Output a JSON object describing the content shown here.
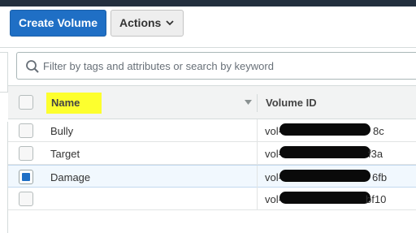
{
  "toolbar": {
    "create_label": "Create Volume",
    "actions_label": "Actions"
  },
  "search": {
    "placeholder": "Filter by tags and attributes or search by keyword"
  },
  "table": {
    "columns": [
      "Name",
      "Volume ID"
    ],
    "rows": [
      {
        "name": "Bully",
        "volume_prefix": "vol-0",
        "volume_suffix": "8c",
        "selected": false
      },
      {
        "name": "Target",
        "volume_prefix": "vol-0",
        "volume_suffix": "f3a",
        "selected": false
      },
      {
        "name": "Damage",
        "volume_prefix": "vol-0",
        "volume_suffix": "6fb",
        "selected": true
      },
      {
        "name": "",
        "volume_prefix": "vol-0",
        "volume_suffix": "bf10",
        "selected": false
      }
    ]
  },
  "colors": {
    "primary": "#1f6fc5",
    "highlight": "#fdff2e",
    "selected_row": "#f1f8fe"
  },
  "icons": [
    "search-icon",
    "chevron-down-icon",
    "sort-icon"
  ]
}
